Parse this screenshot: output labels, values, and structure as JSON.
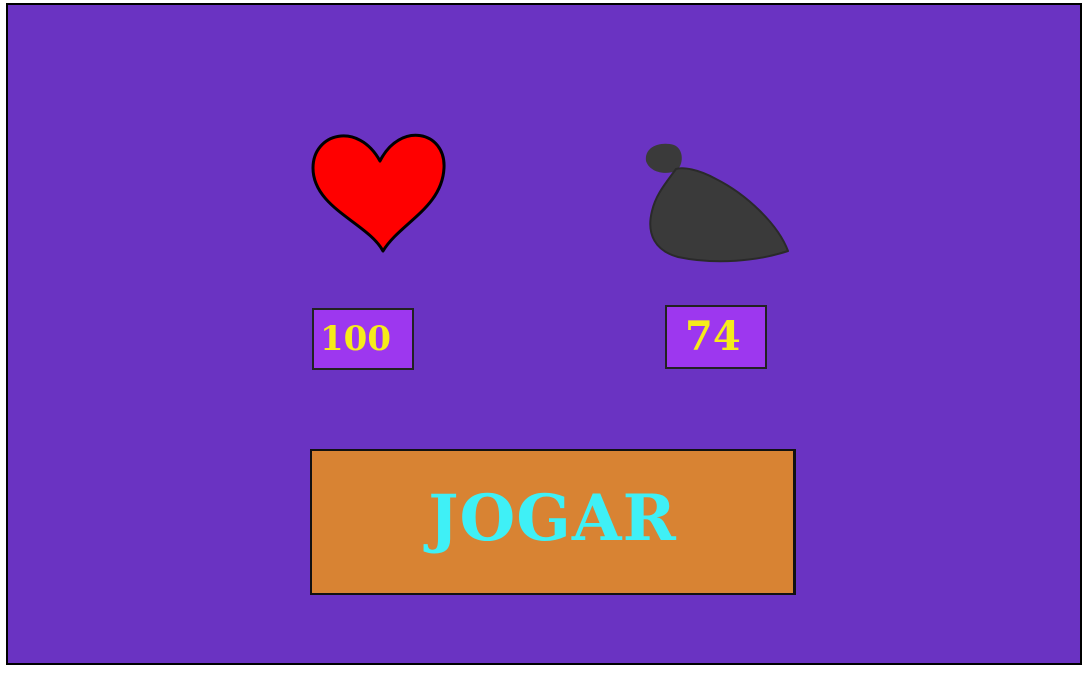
{
  "hud": {
    "life_value": "100",
    "coins_value": "74",
    "life_icon": "heart-icon",
    "coins_icon": "money-bag-icon"
  },
  "actions": {
    "play_label": "JOGAR"
  },
  "colors": {
    "background": "#6a33c2",
    "stat_box": "#9d37ef",
    "stat_text": "#f6ec1a",
    "button": "#d88333",
    "button_text": "#3ff0f6",
    "heart": "#ff0000",
    "bag": "#3a3a3a"
  }
}
